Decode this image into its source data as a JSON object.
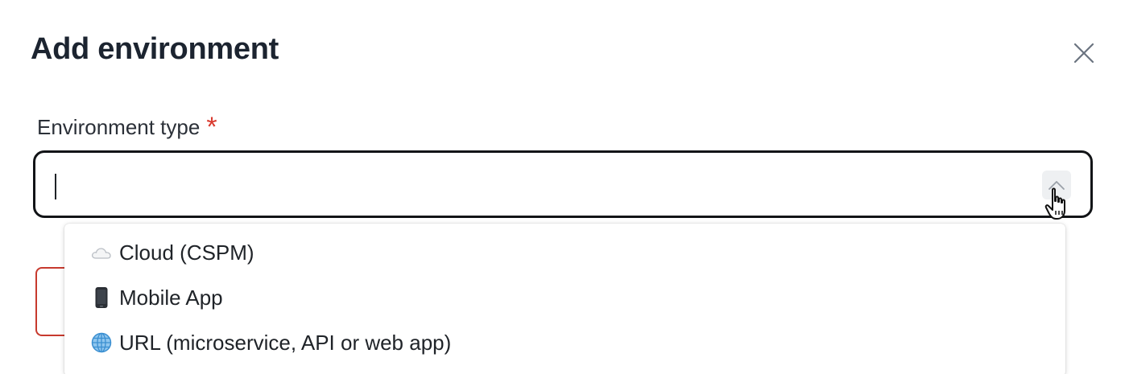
{
  "dialog": {
    "title": "Add environment",
    "close_icon": "close-icon"
  },
  "field": {
    "label": "Environment type",
    "required_marker": "*",
    "value": "",
    "toggle_icon": "chevron-up-icon"
  },
  "dropdown": {
    "options": [
      {
        "icon": "cloud-icon",
        "label": "Cloud (CSPM)"
      },
      {
        "icon": "mobile-phone-icon",
        "label": "Mobile App"
      },
      {
        "icon": "globe-icon",
        "label": "URL (microservice, API or web app)"
      }
    ]
  },
  "colors": {
    "required": "#d93a2f",
    "input_border": "#121417",
    "danger_button_border": "#c73a2e"
  }
}
